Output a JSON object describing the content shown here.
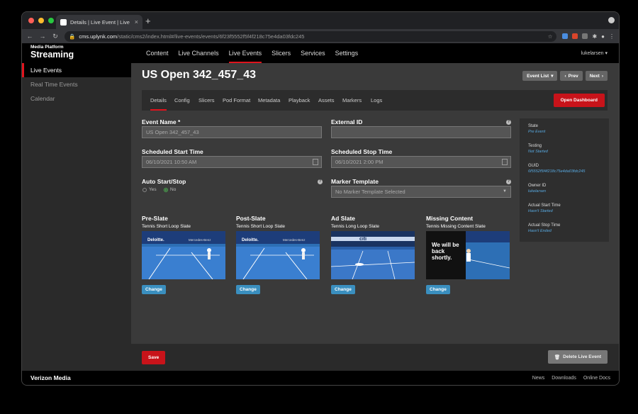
{
  "browser": {
    "tab_title": "Details | Live Event | Live Eve",
    "url_host": "cms.uplynk.com",
    "url_path": "/static/cms2/index.html#/live-events/events/6f23f5552f5f4f218c75e4da03fdc245"
  },
  "header": {
    "logo_small": "Media Platform",
    "logo_big": "Streaming",
    "nav": [
      "Content",
      "Live Channels",
      "Live Events",
      "Slicers",
      "Services",
      "Settings"
    ],
    "active_nav": "Live Events",
    "user": "lukelarsen ▾"
  },
  "sidebar": {
    "items": [
      {
        "label": "Live Events",
        "active": true
      },
      {
        "label": "Real Time Events",
        "active": false
      },
      {
        "label": "Calendar",
        "active": false
      }
    ]
  },
  "page": {
    "title": "US Open 342_457_43",
    "event_list_label": "Event List",
    "prev_label": "Prev",
    "next_label": "Next"
  },
  "subtabs": [
    "Details",
    "Config",
    "Slicers",
    "Pod Format",
    "Metadata",
    "Playback",
    "Assets",
    "Markers",
    "Logs"
  ],
  "open_dashboard_label": "Open Dashboard",
  "form": {
    "event_name_label": "Event Name *",
    "event_name_value": "US Open 342_457_43",
    "external_id_label": "External ID",
    "external_id_value": "",
    "start_label": "Scheduled Start Time",
    "start_value": "06/10/2021 10:50 AM",
    "stop_label": "Scheduled Stop Time",
    "stop_value": "06/10/2021 2:00 PM",
    "auto_label": "Auto Start/Stop",
    "auto_yes": "Yes",
    "auto_no": "No",
    "auto_selected": "No",
    "marker_label": "Marker Template",
    "marker_value": "No Marker Template Selected"
  },
  "slates": [
    {
      "name": "Pre-Slate",
      "slate": "Tennis Short Loop Slate",
      "change": "Change"
    },
    {
      "name": "Post-Slate",
      "slate": "Tennis Short Loop Slate",
      "change": "Change"
    },
    {
      "name": "Ad Slate",
      "slate": "Tennis Long Loop Slate",
      "change": "Change"
    },
    {
      "name": "Missing Content",
      "slate": "Tennis Missing Content Slate",
      "change": "Change",
      "overlay": "We will be back shortly."
    }
  ],
  "thumb_text": {
    "deloitte": "Deloitte.",
    "mercedes": "Mercedes-Benz",
    "citi": "citi"
  },
  "info": [
    {
      "key": "State",
      "value": "Pre Event"
    },
    {
      "key": "Testing",
      "value": "Not Started"
    },
    {
      "key": "GUID",
      "value": "6f5552f5f4f218c75e4da03fdc245"
    },
    {
      "key": "Owner ID",
      "value": "lukelarsen"
    },
    {
      "key": "Actual Start Time",
      "value": "Hasn't Started"
    },
    {
      "key": "Actual Stop Time",
      "value": "Hasn't Ended"
    }
  ],
  "actions": {
    "save": "Save",
    "delete": "Delete Live Event"
  },
  "footer": {
    "brand": "Verizon Media",
    "links": [
      "News",
      "Downloads",
      "Online Docs"
    ]
  },
  "colors": {
    "accent": "#e0131d",
    "link": "#58a9e0",
    "change_btn": "#3a8fbf"
  }
}
